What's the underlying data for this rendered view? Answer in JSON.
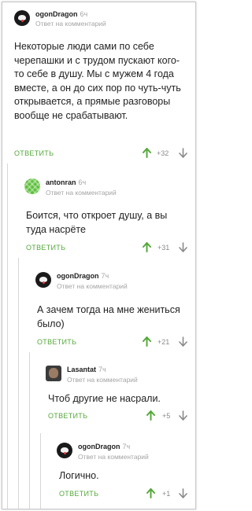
{
  "comments": [
    {
      "author": "ogonDragon",
      "time": "6ч",
      "reply_to": "Ответ на комментарий",
      "text": "Некоторые люди сами по себе черепашки и с трудом пускают кого-то себе в душу. Мы с мужем 4 года вместе, а он до сих пор по чуть-чуть открывается, а прямые разговоры вообще не срабатывают.",
      "reply_label": "ОТВЕТИТЬ",
      "score": "+32"
    },
    {
      "author": "antonran",
      "time": "6ч",
      "reply_to": "Ответ на комментарий",
      "text": "Боится, что откроет душу, а вы туда насрёте",
      "reply_label": "ОТВЕТИТЬ",
      "score": "+31"
    },
    {
      "author": "ogonDragon",
      "time": "7ч",
      "reply_to": "Ответ на комментарий",
      "text": "А зачем тогда на мне жениться было)",
      "reply_label": "ОТВЕТИТЬ",
      "score": "+21"
    },
    {
      "author": "Lasantat",
      "time": "7ч",
      "reply_to": "Ответ на комментарий",
      "text": "Чтоб другие не насрали.",
      "reply_label": "ОТВЕТИТЬ",
      "score": "+5"
    },
    {
      "author": "ogonDragon",
      "time": "7ч",
      "reply_to": "Ответ на комментарий",
      "text": "Логично.",
      "reply_label": "ОТВЕТИТЬ",
      "score": "+1"
    }
  ],
  "colors": {
    "accent": "#55a83b",
    "muted": "#a5a5a5",
    "text": "#222222",
    "thread_line": "#d7d7d7"
  },
  "icons": [
    "ogondragon-avatar",
    "antonran-avatar",
    "lasantat-avatar",
    "upvote-arrow-icon",
    "downvote-arrow-icon"
  ]
}
